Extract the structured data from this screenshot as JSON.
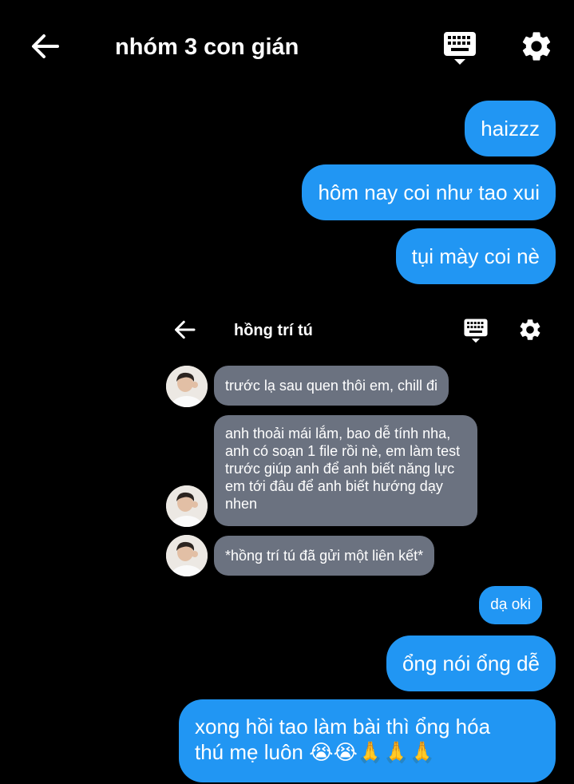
{
  "header": {
    "title": "nhóm 3 con gián",
    "back_icon": "arrow-left-icon",
    "keyboard_icon": "keyboard-hide-icon",
    "settings_icon": "gear-icon"
  },
  "outgoing_top": [
    "haizzz",
    "hôm nay coi như tao xui",
    "tụi mày coi nè"
  ],
  "embedded_screenshot": {
    "title": "hồng trí tú",
    "messages": [
      "trước lạ sau quen thôi em, chill đi",
      "anh thoải mái lắm, bao dễ tính nha, anh có soạn 1 file rồi nè, em làm test trước giúp anh để anh biết năng lực em tới đâu để anh biết hướng dạy nhen",
      "*hồng trí tú đã gửi một liên kết*"
    ],
    "reply": "dạ oki"
  },
  "outgoing_bottom": [
    "ổng nói ổng dễ",
    "xong hồi tao làm bài thì ổng hóa",
    "thú mẹ luôn 😭😭🙏🙏🙏"
  ],
  "colors": {
    "background": "#000000",
    "sent_bubble": "#2196f3",
    "received_bubble": "#6b7280",
    "text": "#ffffff"
  }
}
